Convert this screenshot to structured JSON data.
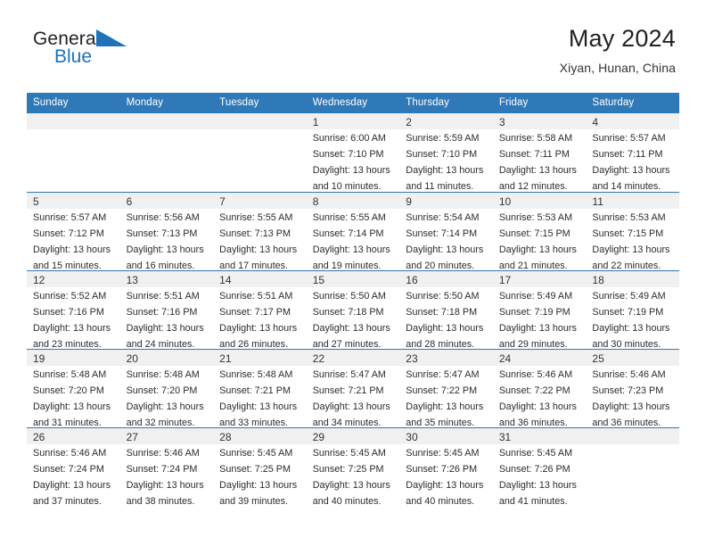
{
  "brand": {
    "name_part1": "General",
    "name_part2": "Blue",
    "mark": "triangle-logo-icon"
  },
  "header": {
    "title": "May 2024",
    "subtitle": "Xiyan, Hunan, China"
  },
  "colors": {
    "header_blue": "#3079b8",
    "brand_blue": "#1d72b8",
    "date_band": "#f0f0f0",
    "text": "#222222"
  },
  "weekdays": [
    "Sunday",
    "Monday",
    "Tuesday",
    "Wednesday",
    "Thursday",
    "Friday",
    "Saturday"
  ],
  "weeks": [
    [
      {
        "day": "",
        "info": ""
      },
      {
        "day": "",
        "info": ""
      },
      {
        "day": "",
        "info": ""
      },
      {
        "day": "1",
        "info": "Sunrise: 6:00 AM\nSunset: 7:10 PM\nDaylight: 13 hours\nand 10 minutes."
      },
      {
        "day": "2",
        "info": "Sunrise: 5:59 AM\nSunset: 7:10 PM\nDaylight: 13 hours\nand 11 minutes."
      },
      {
        "day": "3",
        "info": "Sunrise: 5:58 AM\nSunset: 7:11 PM\nDaylight: 13 hours\nand 12 minutes."
      },
      {
        "day": "4",
        "info": "Sunrise: 5:57 AM\nSunset: 7:11 PM\nDaylight: 13 hours\nand 14 minutes."
      }
    ],
    [
      {
        "day": "5",
        "info": "Sunrise: 5:57 AM\nSunset: 7:12 PM\nDaylight: 13 hours\nand 15 minutes."
      },
      {
        "day": "6",
        "info": "Sunrise: 5:56 AM\nSunset: 7:13 PM\nDaylight: 13 hours\nand 16 minutes."
      },
      {
        "day": "7",
        "info": "Sunrise: 5:55 AM\nSunset: 7:13 PM\nDaylight: 13 hours\nand 17 minutes."
      },
      {
        "day": "8",
        "info": "Sunrise: 5:55 AM\nSunset: 7:14 PM\nDaylight: 13 hours\nand 19 minutes."
      },
      {
        "day": "9",
        "info": "Sunrise: 5:54 AM\nSunset: 7:14 PM\nDaylight: 13 hours\nand 20 minutes."
      },
      {
        "day": "10",
        "info": "Sunrise: 5:53 AM\nSunset: 7:15 PM\nDaylight: 13 hours\nand 21 minutes."
      },
      {
        "day": "11",
        "info": "Sunrise: 5:53 AM\nSunset: 7:15 PM\nDaylight: 13 hours\nand 22 minutes."
      }
    ],
    [
      {
        "day": "12",
        "info": "Sunrise: 5:52 AM\nSunset: 7:16 PM\nDaylight: 13 hours\nand 23 minutes."
      },
      {
        "day": "13",
        "info": "Sunrise: 5:51 AM\nSunset: 7:16 PM\nDaylight: 13 hours\nand 24 minutes."
      },
      {
        "day": "14",
        "info": "Sunrise: 5:51 AM\nSunset: 7:17 PM\nDaylight: 13 hours\nand 26 minutes."
      },
      {
        "day": "15",
        "info": "Sunrise: 5:50 AM\nSunset: 7:18 PM\nDaylight: 13 hours\nand 27 minutes."
      },
      {
        "day": "16",
        "info": "Sunrise: 5:50 AM\nSunset: 7:18 PM\nDaylight: 13 hours\nand 28 minutes."
      },
      {
        "day": "17",
        "info": "Sunrise: 5:49 AM\nSunset: 7:19 PM\nDaylight: 13 hours\nand 29 minutes."
      },
      {
        "day": "18",
        "info": "Sunrise: 5:49 AM\nSunset: 7:19 PM\nDaylight: 13 hours\nand 30 minutes."
      }
    ],
    [
      {
        "day": "19",
        "info": "Sunrise: 5:48 AM\nSunset: 7:20 PM\nDaylight: 13 hours\nand 31 minutes."
      },
      {
        "day": "20",
        "info": "Sunrise: 5:48 AM\nSunset: 7:20 PM\nDaylight: 13 hours\nand 32 minutes."
      },
      {
        "day": "21",
        "info": "Sunrise: 5:48 AM\nSunset: 7:21 PM\nDaylight: 13 hours\nand 33 minutes."
      },
      {
        "day": "22",
        "info": "Sunrise: 5:47 AM\nSunset: 7:21 PM\nDaylight: 13 hours\nand 34 minutes."
      },
      {
        "day": "23",
        "info": "Sunrise: 5:47 AM\nSunset: 7:22 PM\nDaylight: 13 hours\nand 35 minutes."
      },
      {
        "day": "24",
        "info": "Sunrise: 5:46 AM\nSunset: 7:22 PM\nDaylight: 13 hours\nand 36 minutes."
      },
      {
        "day": "25",
        "info": "Sunrise: 5:46 AM\nSunset: 7:23 PM\nDaylight: 13 hours\nand 36 minutes."
      }
    ],
    [
      {
        "day": "26",
        "info": "Sunrise: 5:46 AM\nSunset: 7:24 PM\nDaylight: 13 hours\nand 37 minutes."
      },
      {
        "day": "27",
        "info": "Sunrise: 5:46 AM\nSunset: 7:24 PM\nDaylight: 13 hours\nand 38 minutes."
      },
      {
        "day": "28",
        "info": "Sunrise: 5:45 AM\nSunset: 7:25 PM\nDaylight: 13 hours\nand 39 minutes."
      },
      {
        "day": "29",
        "info": "Sunrise: 5:45 AM\nSunset: 7:25 PM\nDaylight: 13 hours\nand 40 minutes."
      },
      {
        "day": "30",
        "info": "Sunrise: 5:45 AM\nSunset: 7:26 PM\nDaylight: 13 hours\nand 40 minutes."
      },
      {
        "day": "31",
        "info": "Sunrise: 5:45 AM\nSunset: 7:26 PM\nDaylight: 13 hours\nand 41 minutes."
      },
      {
        "day": "",
        "info": ""
      }
    ]
  ]
}
